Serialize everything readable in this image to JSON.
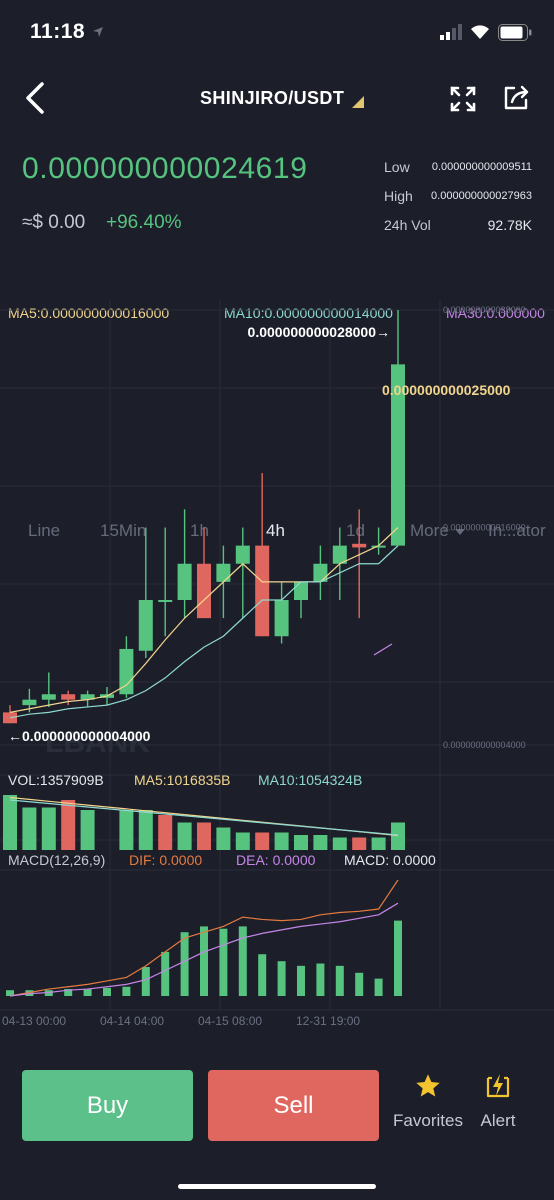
{
  "status": {
    "time": "11:18"
  },
  "header": {
    "pair": "SHINJIRO/USDT"
  },
  "ticker": {
    "price": "0.000000000024619",
    "approx": "≈$ 0.00",
    "change": "+96.40%",
    "low_label": "Low",
    "low_value": "0.000000000009511",
    "high_label": "High",
    "high_value": "0.000000000027963",
    "vol_label": "24h Vol",
    "vol_value": "92.78K"
  },
  "tabs": [
    {
      "label": "Line"
    },
    {
      "label": "15Min"
    },
    {
      "label": "1h"
    },
    {
      "label": "4h",
      "active": true
    },
    {
      "label": "1d"
    },
    {
      "label": "More"
    },
    {
      "label": "In...ator"
    }
  ],
  "indicators": {
    "ma5": "MA5:0.000000000016000",
    "ma10": "MA10:0.000000000014000",
    "ma30": "MA30:0.000000",
    "vol": "VOL:1357909B",
    "vol_ma5": "MA5:1016835B",
    "vol_ma10": "MA10:1054324B",
    "macd_title": "MACD(12,26,9)",
    "dif": "DIF: 0.0000",
    "dea": "DEA: 0.0000",
    "macd": "MACD: 0.0000"
  },
  "chart_labels": {
    "high_marker": "0.000000000028000→",
    "last_marker": "0.000000000025000",
    "low_marker": "←0.000000000004000",
    "axis_top": "0.000000000028000",
    "axis_mid": "0.000000000016000",
    "axis_bottom": "0.000000000004000",
    "watermark": "LBANK"
  },
  "chart_data": {
    "type": "candlestick",
    "ylim": [
      4e-12,
      2.8e-11
    ],
    "x_ticks": [
      "04-13 00:00",
      "04-14 04:00",
      "04-15 08:00",
      "12-31 19:00"
    ],
    "candles": [
      {
        "o": 5.8e-12,
        "h": 6.2e-12,
        "l": 5.2e-12,
        "c": 5.2e-12
      },
      {
        "o": 6.2e-12,
        "h": 7.1e-12,
        "l": 5.8e-12,
        "c": 6.5e-12
      },
      {
        "o": 6.5e-12,
        "h": 8e-12,
        "l": 6.1e-12,
        "c": 6.8e-12
      },
      {
        "o": 6.8e-12,
        "h": 7e-12,
        "l": 6.2e-12,
        "c": 6.5e-12
      },
      {
        "o": 6.5e-12,
        "h": 7e-12,
        "l": 6.1e-12,
        "c": 6.8e-12
      },
      {
        "o": 6.6e-12,
        "h": 7.2e-12,
        "l": 6.2e-12,
        "c": 6.8e-12
      },
      {
        "o": 6.8e-12,
        "h": 1e-11,
        "l": 6.6e-12,
        "c": 9.3e-12
      },
      {
        "o": 9.2e-12,
        "h": 1.6e-11,
        "l": 8.8e-12,
        "c": 1.2e-11
      },
      {
        "o": 1.2e-11,
        "h": 1.6e-11,
        "l": 1e-11,
        "c": 1.2e-11
      },
      {
        "o": 1.2e-11,
        "h": 1.7e-11,
        "l": 1.1e-11,
        "c": 1.4e-11
      },
      {
        "o": 1.4e-11,
        "h": 1.6e-11,
        "l": 1.1e-11,
        "c": 1.1e-11
      },
      {
        "o": 1.3e-11,
        "h": 1.5e-11,
        "l": 1.1e-11,
        "c": 1.4e-11
      },
      {
        "o": 1.4e-11,
        "h": 1.6e-11,
        "l": 1.1e-11,
        "c": 1.5e-11
      },
      {
        "o": 1.5e-11,
        "h": 1.9e-11,
        "l": 1e-11,
        "c": 1e-11
      },
      {
        "o": 1e-11,
        "h": 1.3e-11,
        "l": 9.6e-12,
        "c": 1.2e-11
      },
      {
        "o": 1.2e-11,
        "h": 1.3e-11,
        "l": 1.1e-11,
        "c": 1.3e-11
      },
      {
        "o": 1.3e-11,
        "h": 1.5e-11,
        "l": 1.2e-11,
        "c": 1.4e-11
      },
      {
        "o": 1.4e-11,
        "h": 1.6e-11,
        "l": 1.2e-11,
        "c": 1.5e-11
      },
      {
        "o": 1.51e-11,
        "h": 1.7e-11,
        "l": 1.1e-11,
        "c": 1.49e-11
      },
      {
        "o": 1.49e-11,
        "h": 1.6e-11,
        "l": 1.45e-11,
        "c": 1.5e-11
      },
      {
        "o": 1.5e-11,
        "h": 2.8e-11,
        "l": 1.5e-11,
        "c": 2.5e-11
      }
    ],
    "ma5": [
      5.8e-12,
      6e-12,
      6.2e-12,
      6.4e-12,
      6.5e-12,
      6.7e-12,
      7.3e-12,
      8.5e-12,
      9.8e-12,
      1.1e-11,
      1.2e-11,
      1.3e-11,
      1.4e-11,
      1.3e-11,
      1.3e-11,
      1.3e-11,
      1.3e-11,
      1.4e-11,
      1.45e-11,
      1.5e-11,
      1.6e-11
    ],
    "ma10": [
      5.5e-12,
      5.7e-12,
      5.8e-12,
      6e-12,
      6.1e-12,
      6.2e-12,
      6.5e-12,
      7e-12,
      7.7e-12,
      8.6e-12,
      9.4e-12,
      1e-11,
      1.1e-11,
      1.2e-11,
      1.2e-11,
      1.3e-11,
      1.3e-11,
      1.35e-11,
      1.4e-11,
      1.4e-11,
      1.5e-11
    ],
    "volume": [
      1.1,
      0.85,
      0.85,
      1.0,
      0.8,
      0.0,
      0.8,
      0.8,
      0.7,
      0.55,
      0.55,
      0.45,
      0.35,
      0.35,
      0.35,
      0.3,
      0.3,
      0.25,
      0.25,
      0.25,
      0.55
    ],
    "vol_colors": [
      "up",
      "up",
      "up",
      "down",
      "up",
      "up",
      "up",
      "up",
      "down",
      "up",
      "down",
      "up",
      "up",
      "down",
      "up",
      "up",
      "up",
      "up",
      "down",
      "up",
      "up"
    ],
    "macd_hist": [
      0.05,
      0.05,
      0.05,
      0.06,
      0.06,
      0.07,
      0.08,
      0.25,
      0.38,
      0.55,
      0.6,
      0.58,
      0.6,
      0.36,
      0.3,
      0.26,
      0.28,
      0.26,
      0.2,
      0.15,
      0.65
    ],
    "dif": [
      0.0,
      0.03,
      0.06,
      0.08,
      0.1,
      0.13,
      0.16,
      0.26,
      0.38,
      0.5,
      0.55,
      0.6,
      0.68,
      0.66,
      0.65,
      0.66,
      0.7,
      0.72,
      0.73,
      0.75,
      1.0
    ],
    "dea": [
      0.0,
      0.02,
      0.03,
      0.05,
      0.06,
      0.08,
      0.1,
      0.14,
      0.22,
      0.3,
      0.38,
      0.44,
      0.5,
      0.54,
      0.57,
      0.6,
      0.62,
      0.64,
      0.67,
      0.7,
      0.8
    ]
  },
  "actions": {
    "buy": "Buy",
    "sell": "Sell",
    "favorites": "Favorites",
    "alert": "Alert"
  },
  "colors": {
    "background": "#1c1f2a",
    "up": "#56c37f",
    "down": "#e0675f",
    "ma5": "#f2d58d",
    "ma10": "#8fd8cf",
    "ma30": "#c586e8",
    "dif": "#e57a3f",
    "dea": "#c586e8"
  }
}
